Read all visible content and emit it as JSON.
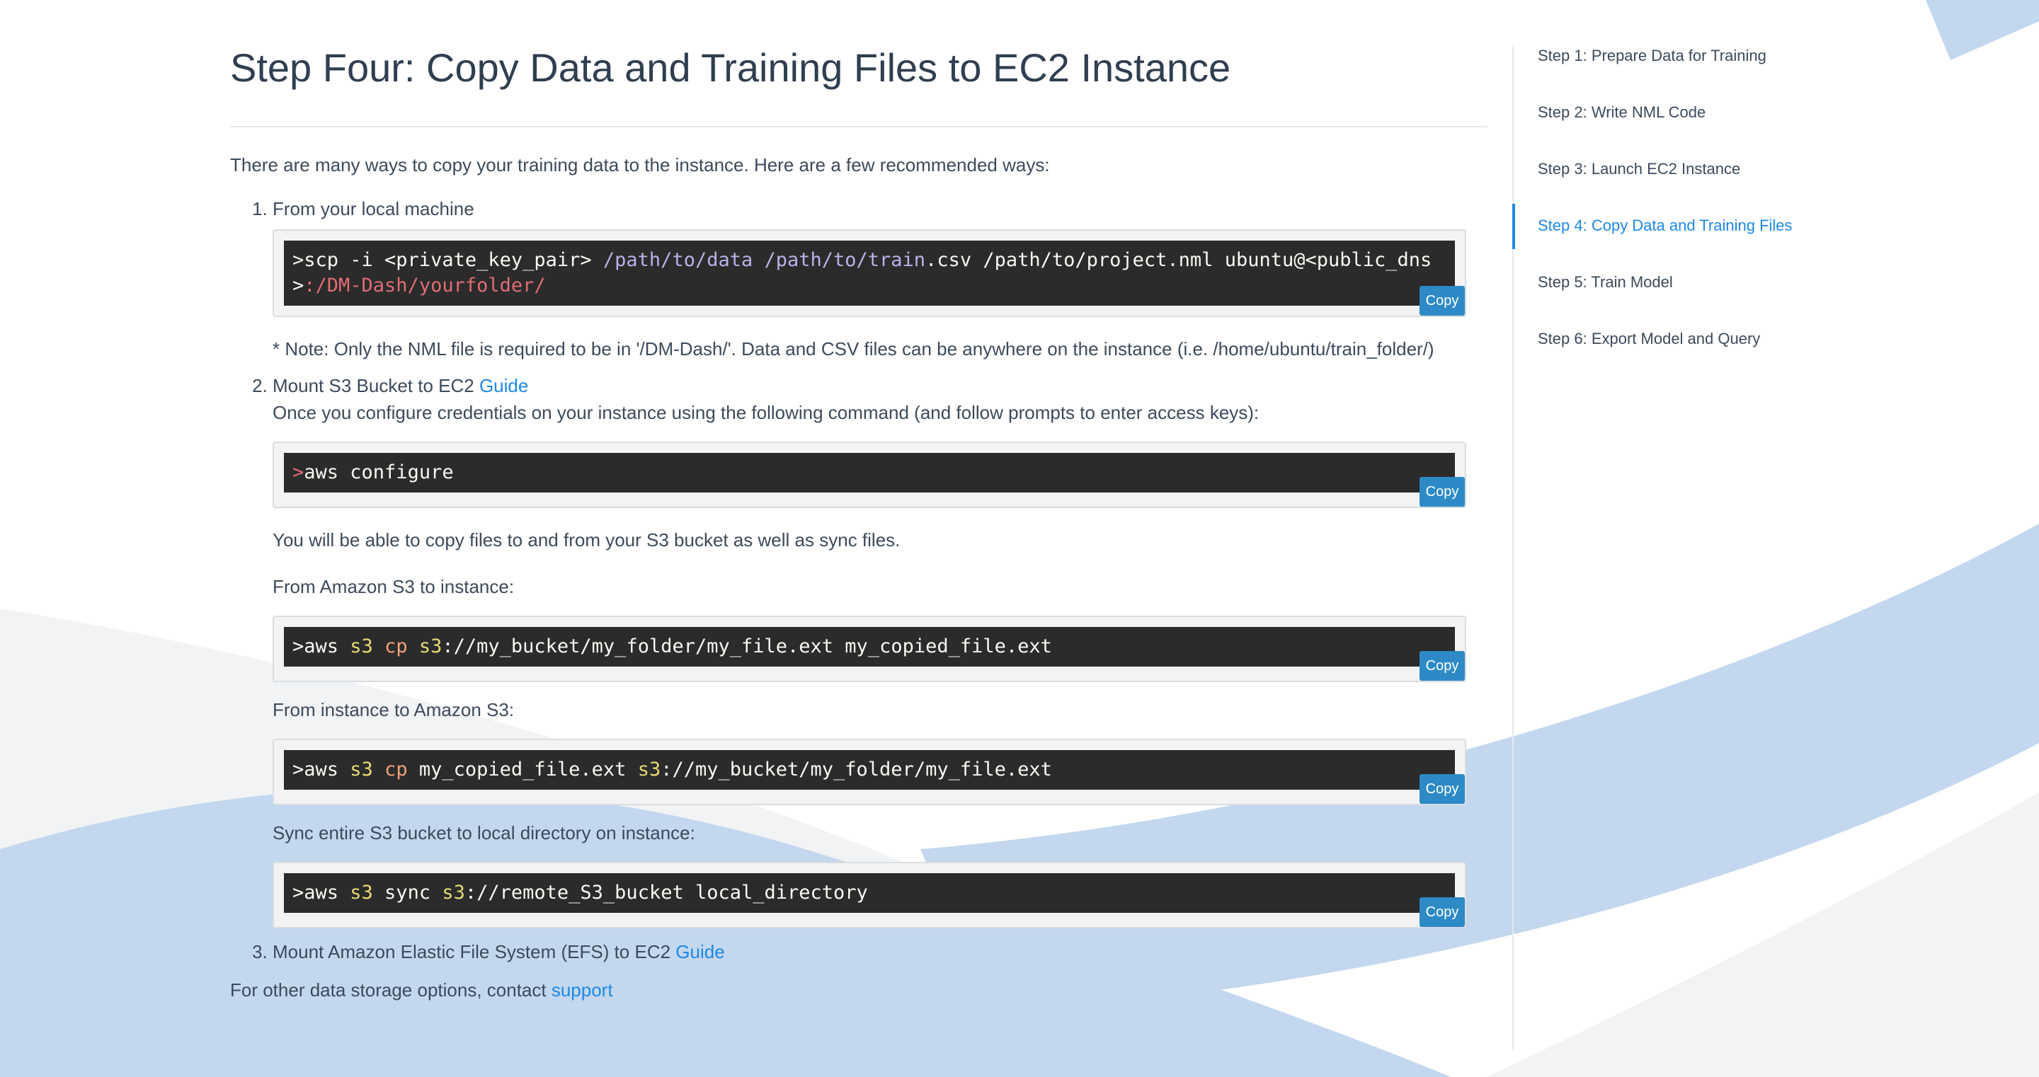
{
  "page": {
    "title": "Step Four: Copy Data and Training Files to EC2 Instance",
    "intro": "There are many ways to copy your training data to the instance. Here are a few recommended ways:"
  },
  "steps": {
    "one": {
      "number": "1.",
      "label": "From your local machine",
      "code": {
        "t1": ">scp -i <private_key_pair> ",
        "t2": "/path/to/data /path/to/train",
        "t3": ".csv /path/to/project.nml ubuntu@<public_dns>",
        "t4": ":/DM-Dash/yourfolder/"
      },
      "note": "* Note: Only the NML file is required to be in '/DM-Dash/'. Data and CSV files can be anywhere on the instance (i.e. /home/ubuntu/train_folder/)"
    },
    "two": {
      "number": "2.",
      "label": "Mount S3 Bucket to EC2 ",
      "link": "Guide",
      "configure_text": "Once you configure credentials on your instance using the following command (and follow prompts to enter access keys):",
      "configure_code": {
        "prompt": ">",
        "cmd": "aws configure"
      },
      "able_text": "You will be able to copy files to and from your S3 bucket as well as sync files.",
      "from_s3_label": "From Amazon S3 to instance:",
      "from_s3_code": {
        "a": ">aws ",
        "s3": "s3",
        "cp": "cp",
        "s3b": "s3",
        "rest": "://my_bucket/my_folder/my_file.ext my_copied_file.ext"
      },
      "to_s3_label": "From instance to Amazon S3:",
      "to_s3_code": {
        "a": ">aws ",
        "s3": "s3",
        "cp": "cp",
        "mid": " my_copied_file.ext ",
        "s3b": "s3",
        "rest": "://my_bucket/my_folder/my_file.ext"
      },
      "sync_label": "Sync entire S3 bucket to local directory on instance:",
      "sync_code": {
        "a": ">aws ",
        "s3": "s3",
        "mid": " sync ",
        "s3b": "s3",
        "rest": "://remote_S3_bucket local_directory"
      }
    },
    "three": {
      "number": "3.",
      "label": "Mount Amazon Elastic File System (EFS) to EC2 ",
      "link": "Guide"
    }
  },
  "footer": {
    "text": "For other data storage options, contact ",
    "link": "support"
  },
  "copy_label": "Copy",
  "sidebar": {
    "items": [
      "Step 1: Prepare Data for Training",
      "Step 2: Write NML Code",
      "Step 3: Launch EC2 Instance",
      "Step 4: Copy Data and Training Files",
      "Step 5: Train Model",
      "Step 6: Export Model and Query"
    ],
    "active_index": 3
  },
  "colors": {
    "accent": "#1e88e5",
    "code_bg": "#2b2b2b",
    "copy_button": "#2d8ac7",
    "background_wave": "#c3d7ee",
    "background_band": "#f2f3f5"
  }
}
